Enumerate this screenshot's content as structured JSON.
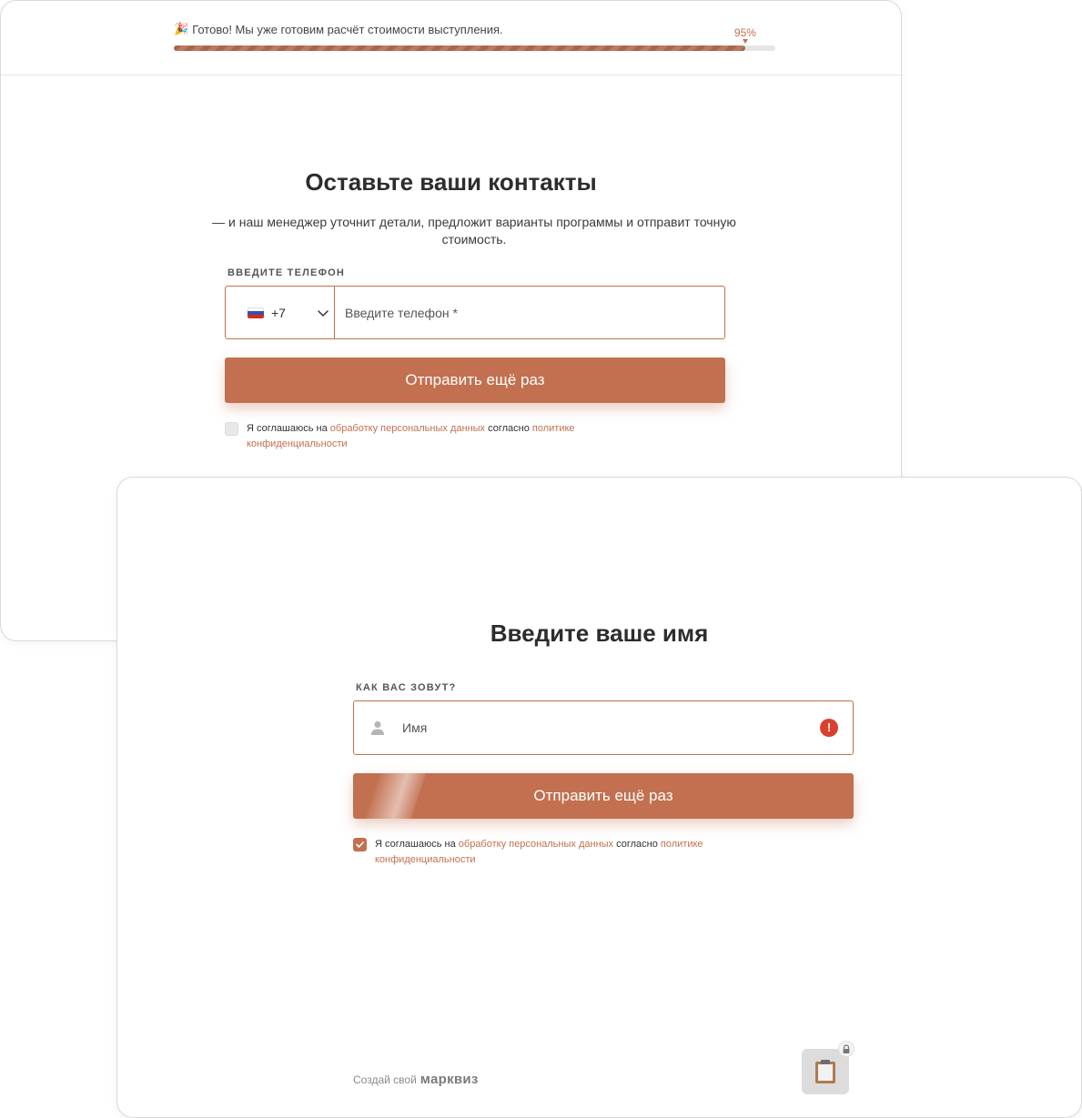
{
  "step_phone": {
    "progress": {
      "emoji": "🎉",
      "message": "Готово! Мы уже готовим расчёт стоимости выступления.",
      "percent_label": "95%",
      "percent_value": 0.95
    },
    "title": "Оставьте ваши контакты",
    "subtitle": "— и наш менеджер уточнит детали, предложит варианты программы и отправит точную стоимость.",
    "field_label": "ВВЕДИТЕ ТЕЛЕФОН",
    "country_code": "+7",
    "phone_placeholder": "Введите телефон *",
    "submit_label": "Отправить ещё раз",
    "consent": {
      "checked": false,
      "prefix": "Я соглашаюсь на ",
      "link1": "обработку персональных данных",
      "middle": " согласно ",
      "link2": "политике конфиденциальности"
    }
  },
  "step_name": {
    "title": "Введите ваше имя",
    "field_label": "КАК ВАС ЗОВУТ?",
    "name_placeholder": "Имя",
    "error_symbol": "!",
    "submit_label": "Отправить ещё раз",
    "consent": {
      "checked": true,
      "prefix": "Я соглашаюсь на ",
      "link1": "обработку персональных данных",
      "middle": " согласно ",
      "link2": "политике конфиденциальности"
    },
    "footer": {
      "prefix": "Создай свой",
      "brand": "марквиз"
    }
  },
  "colors": {
    "accent": "#c2704f",
    "error": "#d8412f",
    "text": "#2d2d2d"
  },
  "icons": [
    "party-icon",
    "russia-flag-icon",
    "chevron-down-icon",
    "person-icon",
    "error-icon",
    "checkmark-icon",
    "clipboard-icon",
    "lock-icon"
  ]
}
